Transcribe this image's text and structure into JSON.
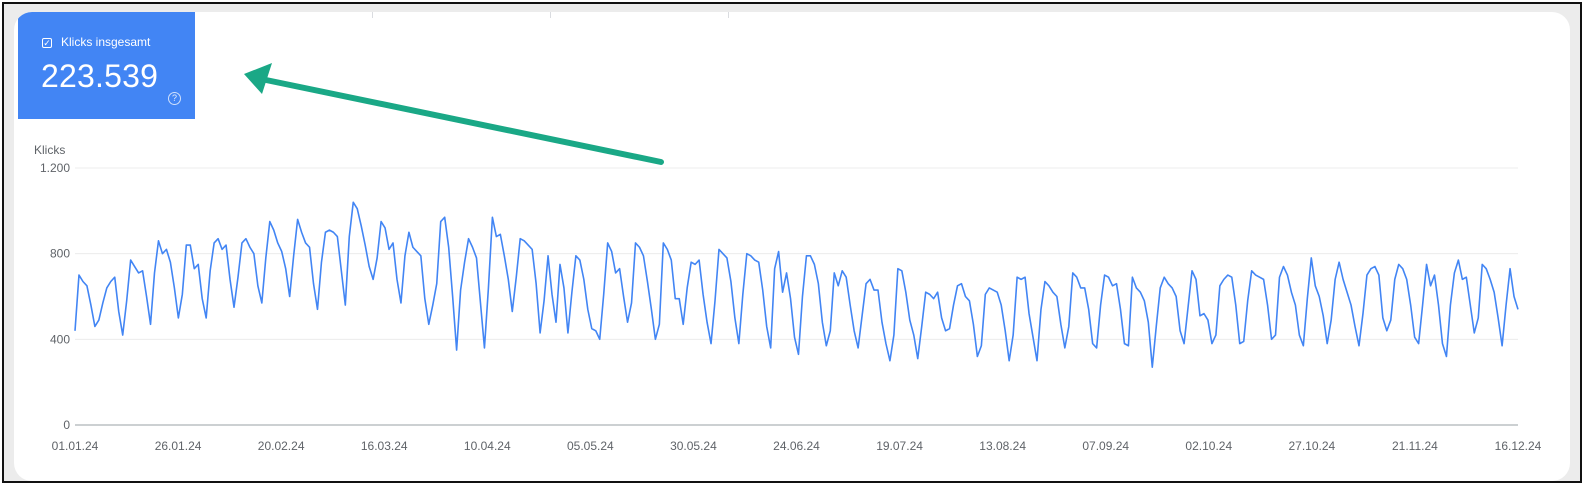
{
  "metric": {
    "label": "Klicks insgesamt",
    "value": "223.539",
    "checked": true,
    "check_icon": "checkbox-checked-icon",
    "help_icon": "help-circle-icon",
    "help_glyph": "?",
    "color": "#4285f4"
  },
  "annotation": {
    "arrow_color": "#1aa886",
    "icon": "arrow-pointer"
  },
  "chart_data": {
    "type": "line",
    "title": "",
    "xlabel": "",
    "ylabel": "Klicks",
    "ylim": [
      0,
      1200
    ],
    "yticks": [
      0,
      400,
      800,
      1200
    ],
    "ytick_labels": [
      "0",
      "400",
      "800",
      "1.200"
    ],
    "xlim": [
      "2024-01-01",
      "2024-12-16"
    ],
    "xtick_dates": [
      "2024-01-01",
      "2024-01-26",
      "2024-02-20",
      "2024-03-16",
      "2024-04-10",
      "2024-05-05",
      "2024-05-30",
      "2024-06-24",
      "2024-07-19",
      "2024-08-13",
      "2024-09-07",
      "2024-10-02",
      "2024-10-27",
      "2024-11-21",
      "2024-12-16"
    ],
    "xtick_labels": [
      "01.01.24",
      "26.01.24",
      "20.02.24",
      "16.03.24",
      "10.04.24",
      "05.05.24",
      "30.05.24",
      "24.06.24",
      "19.07.24",
      "13.08.24",
      "07.09.24",
      "02.10.24",
      "27.10.24",
      "21.11.24",
      "16.12.24"
    ],
    "grid": true,
    "series": [
      {
        "color": "#4285f4",
        "values": [
          440,
          700,
          670,
          650,
          560,
          460,
          490,
          570,
          640,
          670,
          690,
          530,
          420,
          580,
          770,
          740,
          710,
          720,
          600,
          470,
          710,
          860,
          800,
          820,
          760,
          640,
          500,
          610,
          840,
          840,
          730,
          750,
          590,
          500,
          720,
          850,
          870,
          820,
          840,
          680,
          550,
          690,
          850,
          870,
          830,
          800,
          650,
          570,
          780,
          950,
          910,
          850,
          810,
          730,
          600,
          790,
          960,
          900,
          850,
          830,
          660,
          540,
          760,
          900,
          910,
          900,
          880,
          720,
          560,
          880,
          1040,
          1010,
          930,
          840,
          740,
          680,
          780,
          950,
          920,
          820,
          850,
          680,
          570,
          790,
          900,
          830,
          810,
          790,
          590,
          470,
          560,
          660,
          950,
          970,
          830,
          600,
          350,
          630,
          760,
          870,
          830,
          780,
          570,
          360,
          640,
          970,
          880,
          890,
          790,
          680,
          530,
          690,
          870,
          860,
          840,
          820,
          660,
          430,
          580,
          790,
          610,
          480,
          750,
          640,
          430,
          620,
          790,
          770,
          680,
          540,
          450,
          440,
          400,
          610,
          850,
          810,
          710,
          730,
          600,
          480,
          570,
          850,
          830,
          790,
          670,
          540,
          400,
          470,
          850,
          820,
          770,
          590,
          590,
          470,
          640,
          760,
          750,
          770,
          610,
          480,
          380,
          580,
          820,
          800,
          780,
          670,
          500,
          380,
          610,
          800,
          790,
          770,
          760,
          630,
          460,
          360,
          730,
          810,
          620,
          710,
          590,
          410,
          330,
          600,
          790,
          790,
          750,
          660,
          480,
          370,
          440,
          710,
          650,
          720,
          690,
          560,
          440,
          360,
          510,
          660,
          680,
          630,
          630,
          480,
          380,
          300,
          420,
          730,
          720,
          620,
          490,
          420,
          310,
          460,
          620,
          610,
          590,
          620,
          500,
          440,
          450,
          560,
          650,
          660,
          600,
          580,
          470,
          320,
          370,
          610,
          640,
          630,
          620,
          560,
          440,
          300,
          420,
          690,
          680,
          690,
          520,
          410,
          300,
          540,
          670,
          650,
          620,
          600,
          470,
          360,
          460,
          710,
          690,
          640,
          640,
          540,
          380,
          360,
          560,
          700,
          690,
          650,
          660,
          540,
          380,
          370,
          690,
          640,
          620,
          580,
          480,
          270,
          460,
          640,
          690,
          660,
          640,
          600,
          440,
          380,
          550,
          720,
          680,
          510,
          520,
          490,
          380,
          420,
          650,
          680,
          700,
          690,
          560,
          380,
          390,
          580,
          720,
          700,
          690,
          680,
          560,
          400,
          420,
          690,
          740,
          700,
          620,
          560,
          420,
          370,
          590,
          780,
          650,
          600,
          510,
          380,
          490,
          680,
          760,
          680,
          620,
          560,
          460,
          370,
          520,
          700,
          730,
          740,
          700,
          500,
          440,
          490,
          680,
          750,
          730,
          680,
          560,
          410,
          380,
          560,
          750,
          650,
          700,
          560,
          380,
          320,
          560,
          710,
          770,
          680,
          690,
          560,
          430,
          500,
          750,
          730,
          680,
          620,
          500,
          370,
          560,
          730,
          600,
          540
        ]
      }
    ]
  }
}
